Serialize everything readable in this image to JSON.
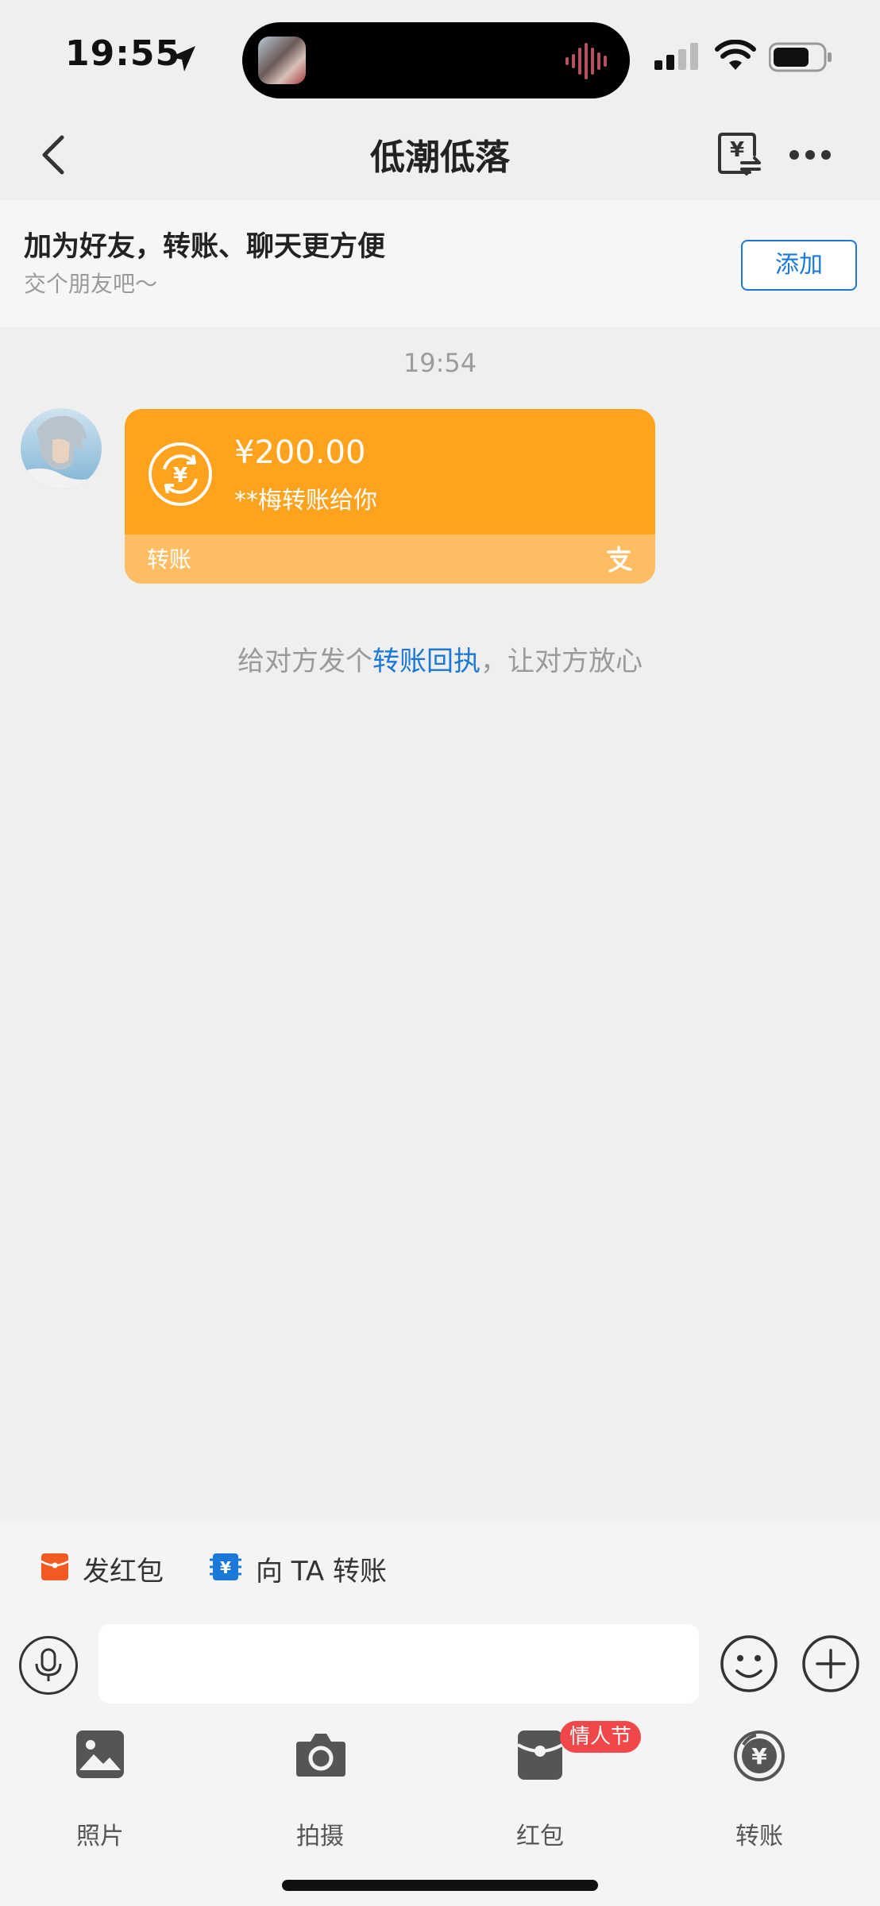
{
  "status_bar": {
    "time": "19:55"
  },
  "header": {
    "title": "低潮低落"
  },
  "banner": {
    "title": "加为好友，转账、聊天更方便",
    "subtitle": "交个朋友吧～",
    "add_label": "添加"
  },
  "chat": {
    "timestamp": "19:54",
    "transfer_card": {
      "amount": "¥200.00",
      "note": "**梅转账给你",
      "label": "转账"
    },
    "receipt_tip": {
      "before": "给对方发个",
      "link": "转账回执",
      "after": "，让对方放心"
    }
  },
  "quick_actions": [
    {
      "label": "发红包",
      "icon": "red-packet-icon"
    },
    {
      "label": "向 TA 转账",
      "icon": "transfer-icon"
    }
  ],
  "input": {
    "placeholder": ""
  },
  "tools": [
    {
      "label": "照片",
      "icon": "photo-icon"
    },
    {
      "label": "拍摄",
      "icon": "camera-icon"
    },
    {
      "label": "红包",
      "icon": "red-packet-icon",
      "badge": "情人节"
    },
    {
      "label": "转账",
      "icon": "transfer-icon"
    }
  ],
  "colors": {
    "accent_blue": "#1a78d8",
    "transfer_orange": "#ffa21e",
    "transfer_orange_light": "#ffbd63",
    "badge_red": "#f0474a",
    "redpacket_orange": "#f25a22"
  }
}
